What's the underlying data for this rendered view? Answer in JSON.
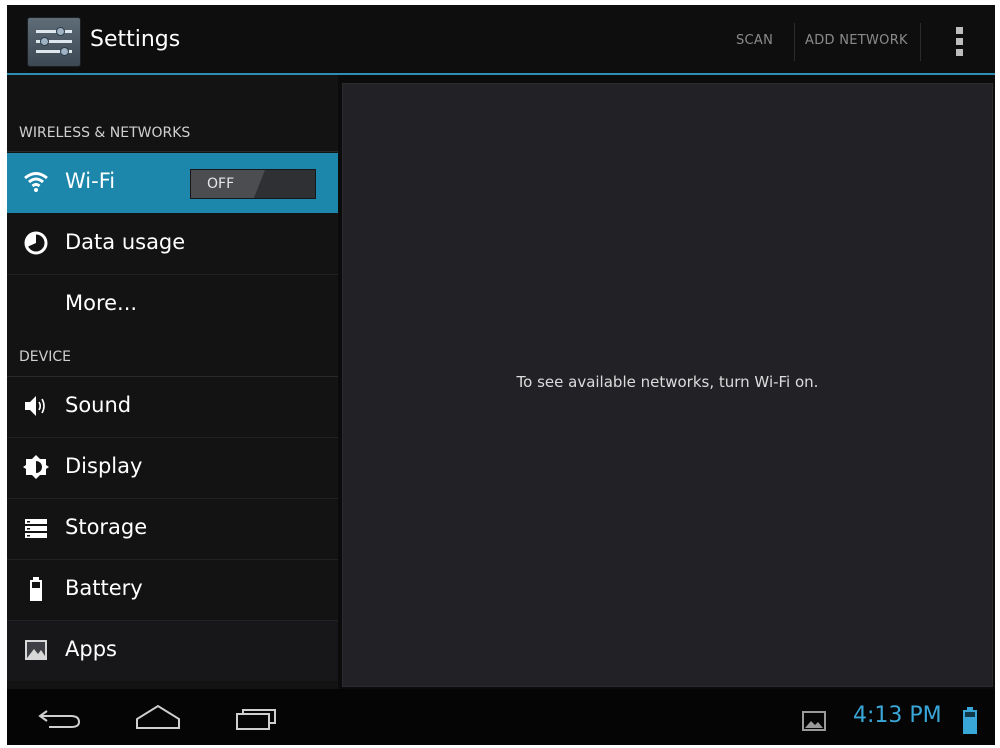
{
  "app": {
    "title": "Settings",
    "icon": "settings-sliders-icon"
  },
  "actionbar": {
    "actions": [
      {
        "label": "SCAN"
      },
      {
        "label": "ADD NETWORK"
      }
    ],
    "overflow_icon": "overflow-menu-icon",
    "accent_color": "#2f8fb3"
  },
  "sidebar": {
    "sections": [
      {
        "header": "WIRELESS & NETWORKS",
        "items": [
          {
            "label": "Wi-Fi",
            "icon": "wifi-icon",
            "selected": true,
            "toggle": "OFF"
          },
          {
            "label": "Data usage",
            "icon": "data-usage-icon"
          },
          {
            "label": "More...",
            "icon": ""
          }
        ]
      },
      {
        "header": "DEVICE",
        "items": [
          {
            "label": "Sound",
            "icon": "speaker-icon"
          },
          {
            "label": "Display",
            "icon": "brightness-icon"
          },
          {
            "label": "Storage",
            "icon": "storage-icon"
          },
          {
            "label": "Battery",
            "icon": "battery-icon"
          },
          {
            "label": "Apps",
            "icon": "apps-icon"
          }
        ]
      }
    ],
    "selected_color": "#1c86ab"
  },
  "detail": {
    "message": "To see available networks, turn Wi-Fi on."
  },
  "navbar": {
    "buttons": [
      "back-icon",
      "home-icon",
      "recent-apps-icon"
    ],
    "status": {
      "time": "4:13 PM",
      "notification_icon": "image-notification-icon",
      "battery_icon": "battery-status-icon",
      "time_color": "#3aa7d9"
    }
  }
}
